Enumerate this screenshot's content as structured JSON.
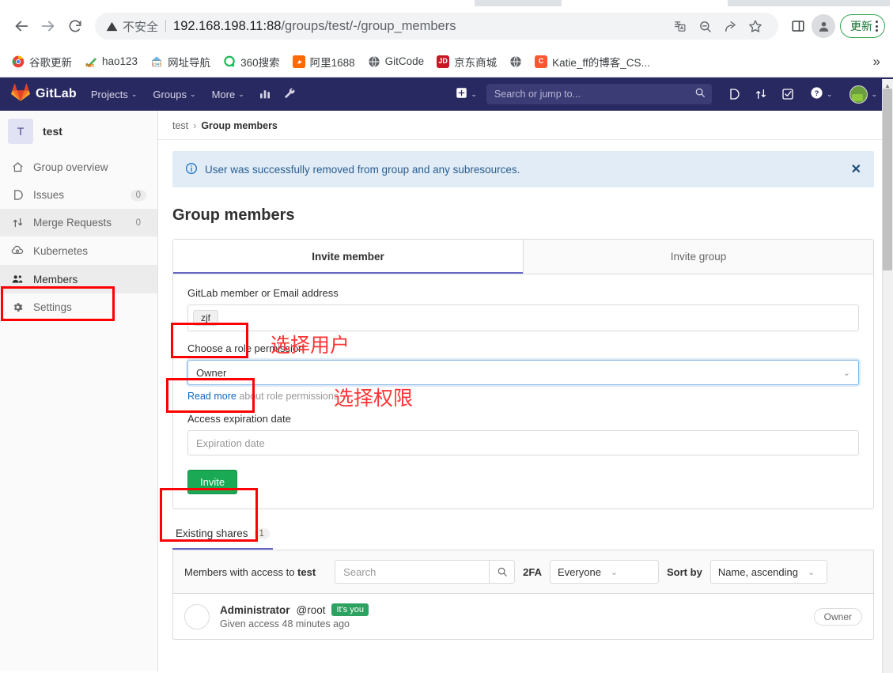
{
  "browser": {
    "security_label": "不安全",
    "url_host": "192.168.198.11:88",
    "url_path": "/groups/test/-/group_members",
    "back_icon": "back-arrow-icon",
    "forward_icon": "forward-arrow-icon",
    "reload_icon": "reload-icon",
    "update_button": "更新",
    "bookmarks": [
      {
        "label": "谷歌更新",
        "favicon_text": "",
        "favicon_color": "#ffffff",
        "icon": "chrome-icon"
      },
      {
        "label": "hao123",
        "favicon_text": "h",
        "favicon_color": "#ffffff",
        "icon": "hao123-icon"
      },
      {
        "label": "网址导航",
        "favicon_text": "",
        "favicon_color": "#ffffff",
        "icon": "2345-nav-icon"
      },
      {
        "label": "360搜索",
        "favicon_text": "",
        "favicon_color": "#ffffff",
        "icon": "360-search-icon"
      },
      {
        "label": "阿里1688",
        "favicon_text": "",
        "favicon_color": "#f60",
        "icon": "alibaba-1688-icon"
      },
      {
        "label": "GitCode",
        "favicon_text": "",
        "favicon_color": "#ffffff",
        "icon": "globe-icon"
      },
      {
        "label": "京东商城",
        "favicon_text": "JD",
        "favicon_color": "#c81623",
        "icon": "jd-icon"
      },
      {
        "label": "",
        "favicon_text": "",
        "favicon_color": "#ffffff",
        "icon": "globe-icon"
      },
      {
        "label": "Katie_ff的博客_CS...",
        "favicon_text": "C",
        "favicon_color": "#fc5531",
        "icon": "csdn-icon"
      }
    ],
    "overflow": "»"
  },
  "gitlab_nav": {
    "brand": "GitLab",
    "items": [
      {
        "label": "Projects",
        "caret": "⌄"
      },
      {
        "label": "Groups",
        "caret": "⌄"
      },
      {
        "label": "More",
        "caret": "⌄"
      }
    ],
    "icons": [
      "analytics-icon",
      "wrench-icon"
    ],
    "plus_caret": "⌄",
    "search_placeholder": "Search or jump to...",
    "right_icons": [
      "issues-icon",
      "merge-requests-icon",
      "todos-icon",
      "help-icon",
      "avatar"
    ],
    "bg_color": "#292961"
  },
  "sidebar": {
    "group_initial": "T",
    "group_name": "test",
    "items": [
      {
        "label": "Group overview",
        "icon": "home-icon",
        "count": null,
        "state": "normal"
      },
      {
        "label": "Issues",
        "icon": "issues-icon",
        "count": "0",
        "state": "normal"
      },
      {
        "label": "Merge Requests",
        "icon": "merge-requests-icon",
        "count": "0",
        "state": "hover"
      },
      {
        "label": "Kubernetes",
        "icon": "kubernetes-icon",
        "count": null,
        "state": "normal"
      },
      {
        "label": "Members",
        "icon": "members-icon",
        "count": null,
        "state": "selected"
      },
      {
        "label": "Settings",
        "icon": "gear-icon",
        "count": null,
        "state": "normal"
      }
    ]
  },
  "breadcrumb": {
    "root": "test",
    "separator": "›",
    "current": "Group members"
  },
  "alert": {
    "icon": "info-icon",
    "message": "User was successfully removed from group and any subresources.",
    "close": "✕",
    "bg_color": "#e1ecf7"
  },
  "page": {
    "title": "Group members"
  },
  "invite_card": {
    "tabs": [
      {
        "label": "Invite member",
        "active": true
      },
      {
        "label": "Invite group",
        "active": false
      }
    ],
    "member_field": {
      "label": "GitLab member or Email address",
      "token": "zjf"
    },
    "role_field": {
      "label": "Choose a role permission",
      "value": "Owner",
      "chevron": "⌄",
      "helper_link": "Read more",
      "helper_rest": " about role permissions"
    },
    "expiration_field": {
      "label": "Access expiration date",
      "placeholder": "Expiration date"
    },
    "submit_label": "Invite",
    "submit_color": "#1aaa55"
  },
  "annotations": [
    {
      "text": "选择用户",
      "color": "#ff3333"
    },
    {
      "text": "选择权限",
      "color": "#ff3333"
    }
  ],
  "existing_shares": {
    "tab_label": "Existing shares",
    "tab_count": "1",
    "toolbar": {
      "lead_prefix": "Members with access to ",
      "lead_group": "test",
      "search_placeholder": "Search",
      "search_icon": "search-icon",
      "twofa_label": "2FA",
      "twofa_value": "Everyone",
      "sort_label": "Sort by",
      "sort_value": "Name, ascending",
      "chevron": "⌄"
    },
    "members": [
      {
        "name": "Administrator",
        "handle": "@root",
        "badge": "It's you",
        "access_text": "Given access 48 minutes ago",
        "role": "Owner"
      }
    ]
  }
}
